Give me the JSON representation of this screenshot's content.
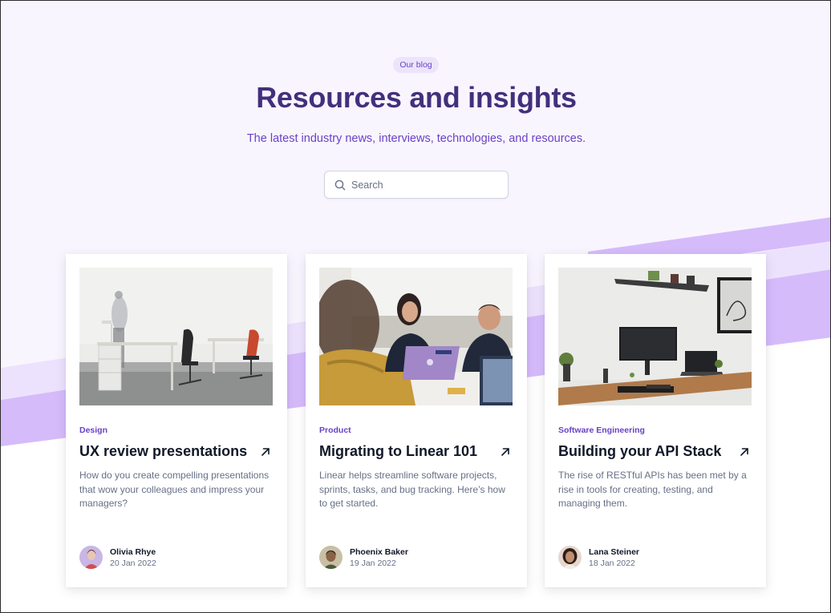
{
  "hero": {
    "badge": "Our blog",
    "title": "Resources and insights",
    "subtitle": "The latest industry news, interviews, technologies, and resources."
  },
  "search": {
    "placeholder": "Search"
  },
  "colors": {
    "background": "#f9f5ff",
    "accent_band_light": "#e9d7fe",
    "accent_band": "#d6bbfb",
    "title": "#42307d",
    "accent": "#6941c6"
  },
  "posts": [
    {
      "category": "Design",
      "title": "UX review presentations",
      "description": "How do you create compelling presentations that wow your colleagues and impress your managers?",
      "author": "Olivia Rhye",
      "date": "20 Jan 2022",
      "image": "office-desks-photo"
    },
    {
      "category": "Product",
      "title": "Migrating to Linear 101",
      "description": "Linear helps streamline software projects, sprints, tasks, and bug tracking. Here’s how to get started.",
      "author": "Phoenix Baker",
      "date": "19 Jan 2022",
      "image": "team-meeting-photo"
    },
    {
      "category": "Software Engineering",
      "title": "Building your API Stack",
      "description": "The rise of RESTful APIs has been met by a rise in tools for creating, testing, and managing them.",
      "author": "Lana Steiner",
      "date": "18 Jan 2022",
      "image": "desk-setup-photo"
    }
  ]
}
